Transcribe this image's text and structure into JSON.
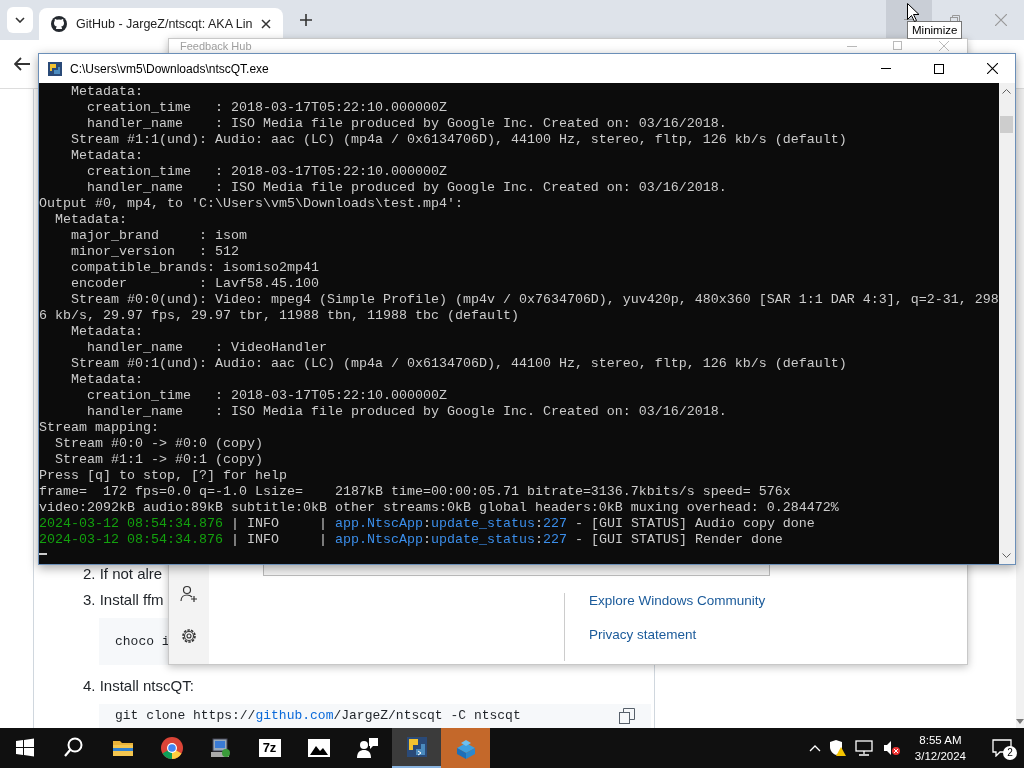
{
  "browser": {
    "tab": {
      "title": "GitHub - JargeZ/ntscqt: AKA Lin",
      "selected": true
    },
    "tooltip": "Minimize",
    "readme": {
      "blocks": [
        {
          "kind": "item",
          "text": "2. If not alre"
        },
        {
          "kind": "item",
          "text": "3. Install ffm"
        },
        {
          "kind": "code",
          "segments": [
            {
              "text": "choco i",
              "kind": "plain"
            }
          ]
        },
        {
          "kind": "item",
          "text": "4. Install ntscQT:"
        },
        {
          "kind": "code",
          "copy": true,
          "segments": [
            {
              "text": "git clone https://",
              "kind": "plain"
            },
            {
              "text": "github.com",
              "kind": "link"
            },
            {
              "text": "/JargeZ/ntscqt -C ntscqt",
              "kind": "plain"
            }
          ]
        }
      ]
    }
  },
  "feedback_hub": {
    "title": "Feedback Hub",
    "links": [
      "Explore Windows Community",
      "Privacy statement"
    ]
  },
  "console": {
    "title": "C:\\Users\\vm5\\Downloads\\ntscQT.exe",
    "lines": [
      "    Metadata:",
      "      creation_time   : 2018-03-17T05:22:10.000000Z",
      "      handler_name    : ISO Media file produced by Google Inc. Created on: 03/16/2018.",
      "    Stream #1:1(und): Audio: aac (LC) (mp4a / 0x6134706D), 44100 Hz, stereo, fltp, 126 kb/s (default)",
      "    Metadata:",
      "      creation_time   : 2018-03-17T05:22:10.000000Z",
      "      handler_name    : ISO Media file produced by Google Inc. Created on: 03/16/2018.",
      "Output #0, mp4, to 'C:\\Users\\vm5\\Downloads\\test.mp4':",
      "  Metadata:",
      "    major_brand     : isom",
      "    minor_version   : 512",
      "    compatible_brands: isomiso2mp41",
      "    encoder         : Lavf58.45.100",
      "    Stream #0:0(und): Video: mpeg4 (Simple Profile) (mp4v / 0x7634706D), yuv420p, 480x360 [SAR 1:1 DAR 4:3], q=2-31, 298",
      "6 kb/s, 29.97 fps, 29.97 tbr, 11988 tbn, 11988 tbc (default)",
      "    Metadata:",
      "      handler_name    : VideoHandler",
      "    Stream #0:1(und): Audio: aac (LC) (mp4a / 0x6134706D), 44100 Hz, stereo, fltp, 126 kb/s (default)",
      "    Metadata:",
      "      creation_time   : 2018-03-17T05:22:10.000000Z",
      "      handler_name    : ISO Media file produced by Google Inc. Created on: 03/16/2018.",
      "Stream mapping:",
      "  Stream #0:0 -> #0:0 (copy)",
      "  Stream #1:1 -> #0:1 (copy)",
      "Press [q] to stop, [?] for help",
      "frame=  172 fps=0.0 q=-1.0 Lsize=    2187kB time=00:00:05.71 bitrate=3136.7kbits/s speed= 576x",
      "video:2092kB audio:89kB subtitle:0kB other streams:0kB global headers:0kB muxing overhead: 0.284472%"
    ],
    "log_lines": [
      {
        "segments": [
          {
            "text": "2024-03-12 08:54:34.876",
            "kind": "time"
          },
          {
            "text": " | INFO     | ",
            "kind": "plain"
          },
          {
            "text": "app.NtscApp",
            "kind": "source"
          },
          {
            "text": ":",
            "kind": "plain"
          },
          {
            "text": "update_status",
            "kind": "source"
          },
          {
            "text": ":",
            "kind": "plain"
          },
          {
            "text": "227",
            "kind": "source"
          },
          {
            "text": " - [GUI STATUS] Audio copy done",
            "kind": "plain"
          }
        ]
      },
      {
        "segments": [
          {
            "text": "2024-03-12 08:54:34.876",
            "kind": "time"
          },
          {
            "text": " | INFO     | ",
            "kind": "plain"
          },
          {
            "text": "app.NtscApp",
            "kind": "source"
          },
          {
            "text": ":",
            "kind": "plain"
          },
          {
            "text": "update_status",
            "kind": "source"
          },
          {
            "text": ":",
            "kind": "plain"
          },
          {
            "text": "227",
            "kind": "source"
          },
          {
            "text": " - [GUI STATUS] Render done",
            "kind": "plain"
          }
        ]
      }
    ]
  },
  "taskbar": {
    "apps": [
      {
        "kind": "start",
        "active": false,
        "flashing": false
      },
      {
        "kind": "search",
        "active": false,
        "flashing": false
      },
      {
        "kind": "folder",
        "active": false,
        "flashing": false
      },
      {
        "kind": "chrome",
        "active": false,
        "flashing": false
      },
      {
        "kind": "installer",
        "active": false,
        "flashing": false
      },
      {
        "kind": "archive",
        "label": "7z",
        "active": false,
        "flashing": false
      },
      {
        "kind": "photos",
        "active": false,
        "flashing": false
      },
      {
        "kind": "people",
        "active": false,
        "flashing": false
      },
      {
        "kind": "python",
        "active": true,
        "flashing": false
      },
      {
        "kind": "bricks",
        "active": false,
        "flashing": true
      }
    ],
    "clock": {
      "time": "8:55 AM",
      "date": "3/12/2024"
    },
    "notifications": "2"
  }
}
